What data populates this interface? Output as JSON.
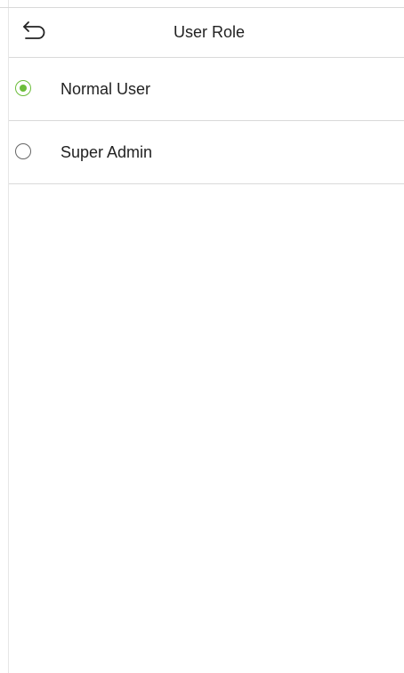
{
  "header": {
    "title": "User Role",
    "back_icon": "back-arrow-icon"
  },
  "options": [
    {
      "label": "Normal User",
      "selected": true
    },
    {
      "label": "Super Admin",
      "selected": false
    }
  ],
  "colors": {
    "accent": "#6cbd3a",
    "divider": "#d9d9d9",
    "text": "#222222"
  }
}
